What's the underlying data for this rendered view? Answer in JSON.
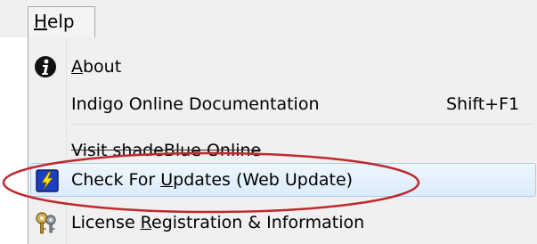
{
  "menubar": {
    "help": {
      "prefix": "",
      "mnemonic": "H",
      "rest": "elp"
    }
  },
  "items": [
    {
      "pre": "",
      "mnemonic": "A",
      "post": "bout",
      "shortcut": ""
    },
    {
      "pre": "Indigo Online Documentation",
      "mnemonic": "",
      "post": "",
      "shortcut": "Shift+F1"
    },
    {
      "pre": "Visit shadeBlue Online",
      "mnemonic": "",
      "post": "",
      "shortcut": ""
    },
    {
      "pre": "Check For ",
      "mnemonic": "U",
      "post": "pdates (Web Update)",
      "shortcut": ""
    },
    {
      "pre": "License ",
      "mnemonic": "R",
      "post": "egistration & Information",
      "shortcut": ""
    }
  ],
  "icons": {
    "about": "info-icon",
    "updates": "lightning-icon",
    "license": "keys-icon"
  },
  "colors": {
    "highlight_fill": "#dcecfc",
    "highlight_border": "#a7ccf0",
    "annotation_ellipse": "#c0282d"
  }
}
